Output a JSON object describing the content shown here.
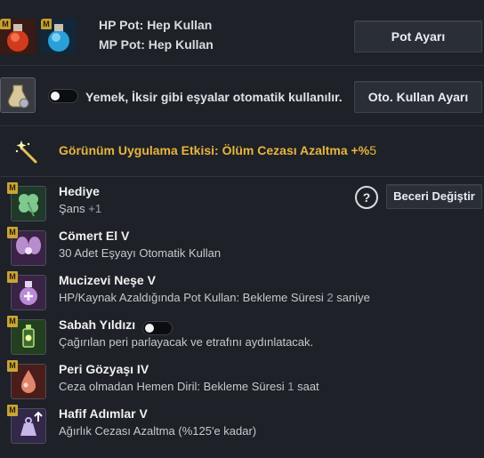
{
  "pot": {
    "hp_line": "HP Pot: Hep Kullan",
    "mp_line": "MP Pot: Hep Kullan",
    "settings_button": "Pot Ayarı",
    "hp_badge": "M",
    "mp_badge": "M"
  },
  "auto_use": {
    "label": "Yemek, İksir gibi eşyalar otomatik kullanılır.",
    "toggle_on": false,
    "settings_button": "Oto. Kullan Ayarı"
  },
  "effect": {
    "text": "Görünüm Uygulama Etkisi: Ölüm Cezası Azaltma +%",
    "value": "5"
  },
  "skills_header": {
    "help_label": "?",
    "change_button": "Beceri Değiştir"
  },
  "skills": [
    {
      "badge": "M",
      "name": "Hediye",
      "desc": "Şans",
      "desc_num": "+1",
      "icon": "clover-icon"
    },
    {
      "badge": "M",
      "name": "Cömert El V",
      "desc": "30 Adet Eşyayı Otomatik Kullan",
      "desc_num": "",
      "icon": "fairy-icon"
    },
    {
      "badge": "M",
      "name": "Mucizevi Neşe V",
      "desc": "HP/Kaynak Azaldığında Pot Kullan: Bekleme Süresi",
      "desc_num": "2",
      "desc_after": "saniye",
      "icon": "potion-plus-icon"
    },
    {
      "badge": "M",
      "name": "Sabah Yıldızı",
      "desc": "Çağırılan peri parlayacak ve etrafını aydınlatacak.",
      "desc_num": "",
      "icon": "lantern-icon",
      "toggle_on": true
    },
    {
      "badge": "M",
      "name": "Peri Gözyaşı IV",
      "desc": "Ceza olmadan Hemen Diril: Bekleme Süresi",
      "desc_num": "1",
      "desc_after": "saat",
      "icon": "tear-icon"
    },
    {
      "badge": "M",
      "name": "Hafif Adımlar V",
      "desc": "Ağırlık Cezası Azaltma (%125'e kadar)",
      "desc_num": "",
      "icon": "weight-icon"
    }
  ]
}
